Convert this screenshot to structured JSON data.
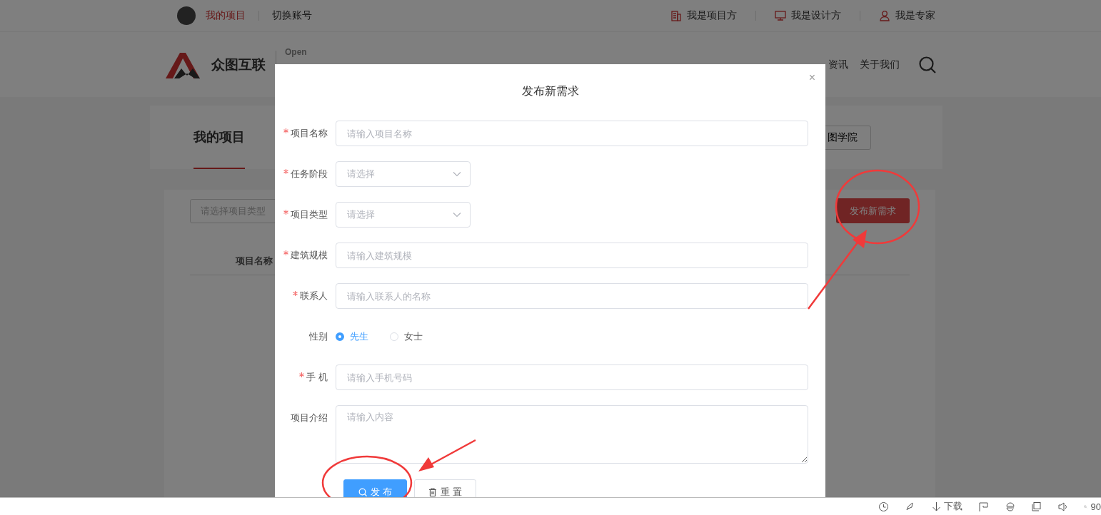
{
  "top_bar": {
    "account": "我的项目",
    "switch": "切换账号",
    "roles": [
      {
        "label": "我是项目方"
      },
      {
        "label": "我是设计方"
      },
      {
        "label": "我是专家"
      }
    ]
  },
  "header": {
    "brand": "众图互联",
    "tagline": [
      "Open"
    ],
    "nav": [
      "资讯",
      "关于我们"
    ]
  },
  "page": {
    "tab": "我的项目",
    "side_button": "图学院",
    "filter_placeholder": "请选择项目类型",
    "publish_button": "发布新需求",
    "table_columns": [
      "项目名称"
    ]
  },
  "dialog": {
    "title": "发布新需求",
    "close": "×",
    "fields": [
      {
        "kind": "text",
        "label": "项目名称",
        "required": true,
        "placeholder": "请输入项目名称"
      },
      {
        "kind": "select",
        "label": "任务阶段",
        "required": true,
        "placeholder": "请选择"
      },
      {
        "kind": "select",
        "label": "项目类型",
        "required": true,
        "placeholder": "请选择"
      },
      {
        "kind": "text",
        "label": "建筑规模",
        "required": true,
        "placeholder": "请输入建筑规模"
      },
      {
        "kind": "text",
        "label": "联系人",
        "required": true,
        "placeholder": "请输入联系人的名称"
      },
      {
        "kind": "radio",
        "label": "性别",
        "required": false,
        "options": [
          {
            "label": "先生",
            "selected": true
          },
          {
            "label": "女士",
            "selected": false
          }
        ]
      },
      {
        "kind": "text",
        "label": "手 机",
        "required": true,
        "placeholder": "请输入手机号码"
      },
      {
        "kind": "textarea",
        "label": "项目介绍",
        "required": false,
        "placeholder": "请输入内容"
      }
    ],
    "buttons": [
      {
        "label": "发 布",
        "kind": "primary"
      },
      {
        "label": "重 置",
        "kind": "default"
      }
    ]
  },
  "browser_status": {
    "download": "下载",
    "zoom": "90"
  }
}
